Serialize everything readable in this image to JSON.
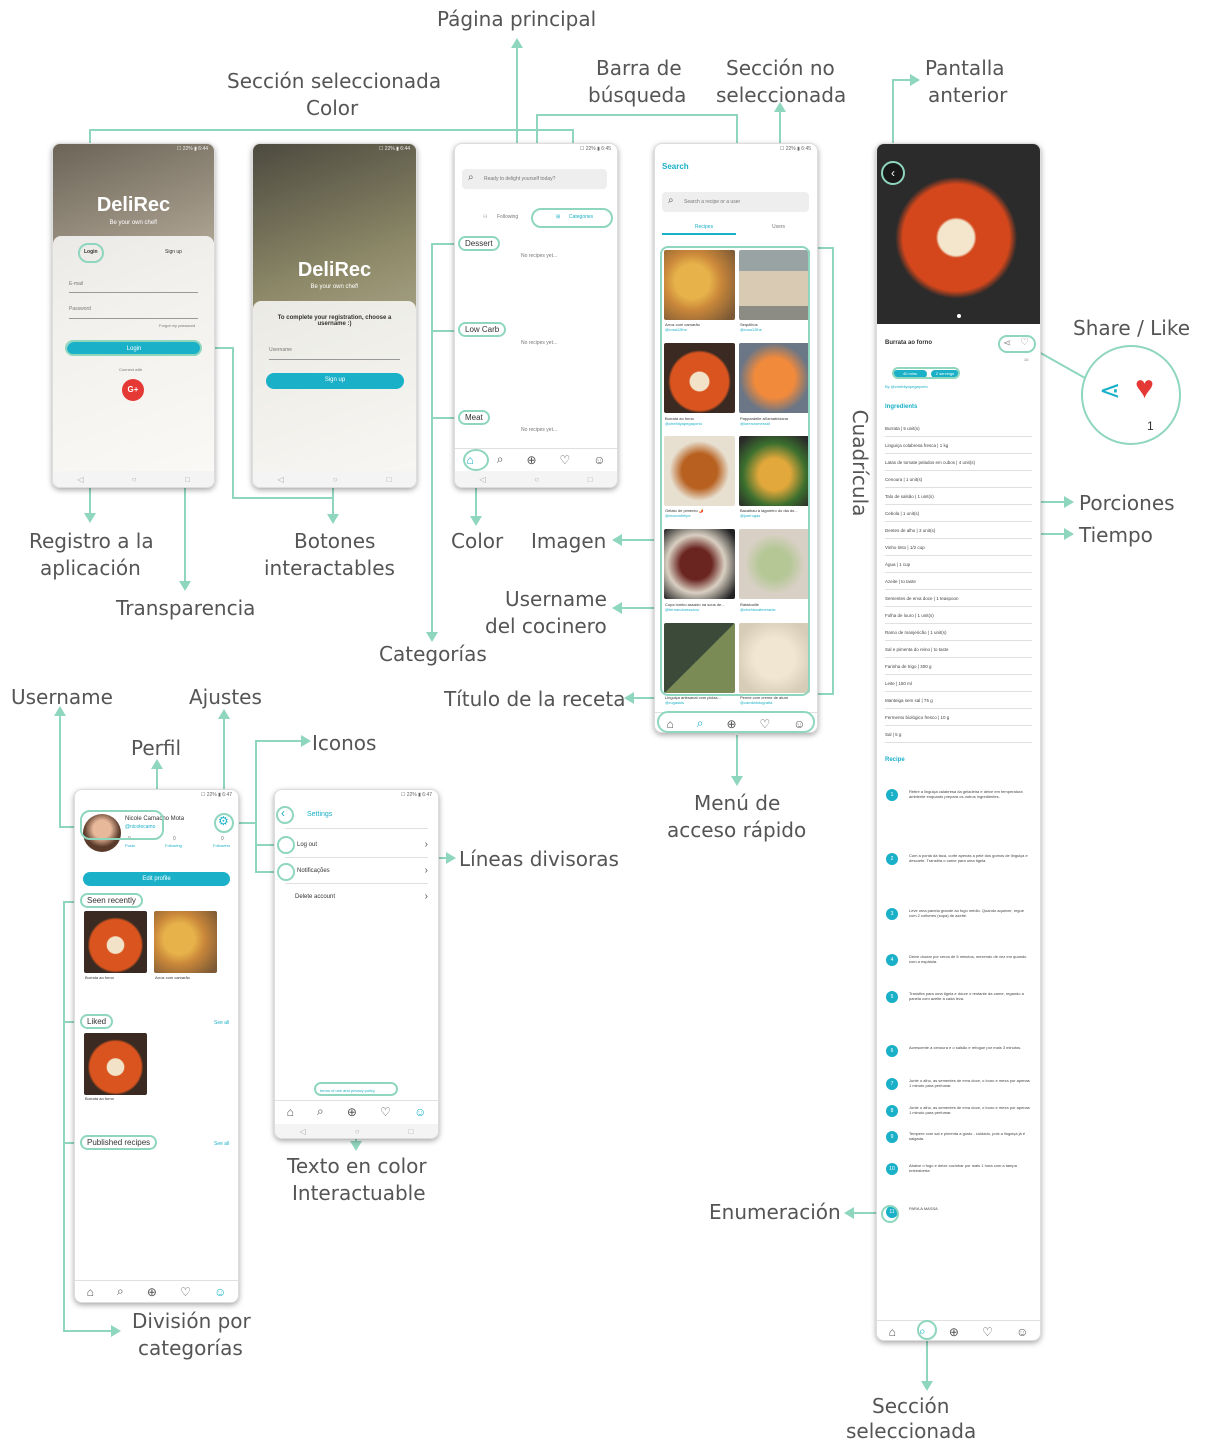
{
  "annotations": {
    "pagina_principal": "Página principal",
    "seccion_seleccionada_color_1": "Sección seleccionada",
    "seccion_seleccionada_color_2": "Color",
    "barra_busqueda_1": "Barra de",
    "barra_busqueda_2": "búsqueda",
    "seccion_no_seleccionada_1": "Sección no",
    "seccion_no_seleccionada_2": "seleccionada",
    "pantalla_anterior_1": "Pantalla",
    "pantalla_anterior_2": "anterior",
    "share_like": "Share / Like",
    "porciones": "Porciones",
    "tiempo": "Tiempo",
    "cuadricula": "Cuadrícula",
    "registro_1": "Registro a la",
    "registro_2": "aplicación",
    "transparencia": "Transparencia",
    "botones_1": "Botones",
    "botones_2": "interactables",
    "color": "Color",
    "imagen": "Imagen",
    "username_cocinero_1": "Username",
    "username_cocinero_2": "del cocinero",
    "categorias": "Categorías",
    "titulo_receta": "Título de la receta",
    "menu_acceso_1": "Menú de",
    "menu_acceso_2": "acceso rápido",
    "username": "Username",
    "ajustes": "Ajustes",
    "perfil": "Perfil",
    "iconos": "Iconos",
    "lineas_divisoras": "Líneas divisoras",
    "texto_color_1": "Texto en color",
    "texto_color_2": "Interactuable",
    "enumeracion": "Enumeración",
    "division_1": "División por",
    "division_2": "categorías",
    "seccion_seleccionada_1": "Sección",
    "seccion_seleccionada_2": "seleccionada"
  },
  "login_screen": {
    "logo": "DeliRec",
    "tagline": "Be your own chef!",
    "tab_login": "Login",
    "tab_signup": "Sign up",
    "email_label": "E-mail",
    "password_label": "Password",
    "forgot": "Forgot my password",
    "login_button": "Login",
    "connect_with": "Connect with",
    "google": "G+"
  },
  "register_screen": {
    "logo": "DeliRec",
    "tagline": "Be your own chef!",
    "prompt": "To complete your registration, choose a username :)",
    "username_label": "Username",
    "signup_button": "Sign up"
  },
  "home_screen": {
    "search_placeholder": "Ready to delight yourself today?",
    "tab_following": "Following",
    "tab_categories": "Categories",
    "categories": [
      {
        "name": "Dessert",
        "empty": "No recipes yet..."
      },
      {
        "name": "Low Carb",
        "empty": "No recipes yet..."
      },
      {
        "name": "Meat",
        "empty": "No recipes yet..."
      }
    ]
  },
  "search_screen": {
    "title": "Search",
    "placeholder": "Search a recipe or a user",
    "tab_recipes": "Recipes",
    "tab_users": "Users",
    "recipes": [
      {
        "title": "Arroz com camarão",
        "user": "@rosa12fhe"
      },
      {
        "title": "Sequilhos",
        "user": "@rosa12fhe"
      },
      {
        "title": "Burrata ao forno",
        "user": "@chefdiyapegaporto"
      },
      {
        "title": "Pappardelle all'amatriciana",
        "user": "@lorenzomessid"
      },
      {
        "title": "Gelato de pimento 🌶️",
        "user": "@marciofelipe"
      },
      {
        "title": "Bacalhau à lagareiro do dia do...",
        "user": "@joelrogas"
      },
      {
        "title": "Copa lombo assado na sous de...",
        "user": "@fernandoressano"
      },
      {
        "title": "Ratatouille",
        "user": "@chefducalmeranie"
      },
      {
        "title": "Linguiça artesanal com piclas...",
        "user": "@rogaskis"
      },
      {
        "title": "Penne com creme de atum",
        "user": "@camilafotografia"
      }
    ]
  },
  "recipe_screen": {
    "title": "Burrata ao forno",
    "likes": "10",
    "time": "40 mins",
    "servings": "2 servings",
    "by": "By @chefdiyapegaporto",
    "ingredients_title": "Ingredients",
    "ingredients": [
      "Burrata | 5 unit(s)",
      "Linguiça colabresa fresca | 1 kg",
      "Latas de tomate pelados em cubos | 4 unit(s)",
      "Cenoura | 1 unit(s)",
      "Talo de salsão | 1 unit(s)",
      "Cebola | 1 unit(s)",
      "Dentes de alho | 3 unit(s)",
      "Vinho tinto | 1/2 cup",
      "Água | 1 cup",
      "Azeite | to taste",
      "Sementes de erva doce | 1 teaspoon",
      "Folha de louro | 1 unit(s)",
      "Ramo de manjericão | 1 unit(s)",
      "Sal e pimenta do reino | to taste",
      "Farinha de trigo | 300 g",
      "Leite | 150 ml",
      "Manteiga sem sal | 75 g",
      "Fermento biológico fresco | 10 g",
      "Sal | 5 g"
    ],
    "recipe_title": "Recipe",
    "steps": [
      "Retire a linguiça calabresa da geladeira e deixe em temperatura ambiente enquanto prepara os outros ingredientes.",
      "Com a ponta da faca, corte apenas a pele dos gomos de linguiça e descarte. Transfira o carne para uma tigela.",
      "Leve uma panela grande ao fogo médio. Quando aquecer, regue com 2 colheres (sopa) de azeite.",
      "Deixe dourar por cerca de 5 minutos, mexendo de vez em quando com a espátula.",
      "Transfira para uma tigela e doure o restante da carne, regando a panela com azeite a cada leva.",
      "Acrescente a cenoura e o salsão e refogue por mais 3 minutos.",
      "Junte o alho, as sementes de erva doce, o louro e mexa por apenas 1 minuto para perfumar.",
      "Junte o alho, as sementes de erva doce, o louro e mexa por apenas 1 minuto para perfumar.",
      "Tempere com sal e pimenta a gosto - cuidado, pois a linguiça já é salgada.",
      "Abaixe o fogo e deixe cozinhar por mais 1 hora com a tampa entreaberta.",
      "PARA A MASSA"
    ]
  },
  "profile_screen": {
    "name": "Nicole Camacho Mota",
    "handle": "@nicolecamo",
    "stats": [
      {
        "value": "0",
        "label": "Posts"
      },
      {
        "value": "0",
        "label": "Following"
      },
      {
        "value": "0",
        "label": "Followers"
      }
    ],
    "edit_profile": "Edit profile",
    "seen_recently": "Seen recently",
    "seen_items": [
      "Burrata ao forno",
      "Arroz com camarão"
    ],
    "liked": "Liked",
    "see_all": "See all",
    "liked_items": [
      "Burrata ao forno"
    ],
    "published": "Published recipes"
  },
  "settings_screen": {
    "title": "Settings",
    "items": [
      "Log out",
      "Notificações",
      "Delete account"
    ],
    "terms": "terms of use and privacy policy"
  },
  "share_like_badge": {
    "count": "1"
  },
  "colors": {
    "accent": "#1ab0c8",
    "annotation": "#8fd6bf",
    "like": "#e53935"
  },
  "icons": [
    "home-icon",
    "search-icon",
    "add-icon",
    "heart-icon",
    "profile-icon",
    "share-icon",
    "back-icon",
    "gear-icon",
    "logout-icon",
    "bell-icon",
    "google-icon"
  ]
}
